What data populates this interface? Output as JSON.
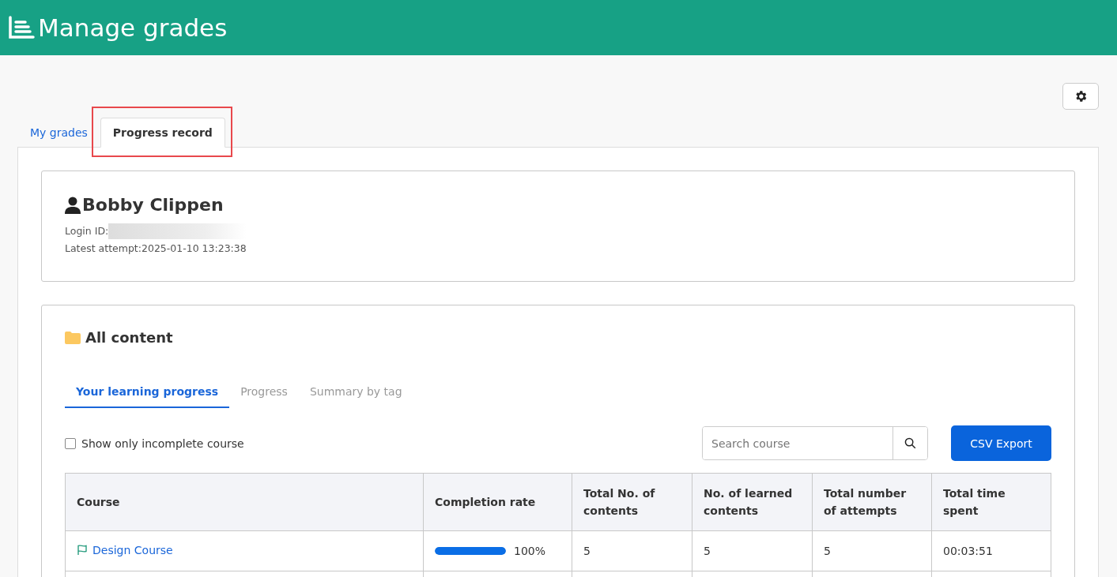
{
  "header": {
    "title": "Manage grades"
  },
  "page_tabs": [
    {
      "label": "My grades",
      "selected": false
    },
    {
      "label": "Progress record",
      "selected": true
    }
  ],
  "profile": {
    "name": "Bobby Clippen",
    "login_id_label": "Login ID:",
    "latest_attempt": "Latest attempt:2025-01-10 13:23:38"
  },
  "content": {
    "title": "All content",
    "tabs": [
      {
        "label": "Your learning progress",
        "selected": true
      },
      {
        "label": "Progress",
        "selected": false
      },
      {
        "label": "Summary by tag",
        "selected": false
      }
    ],
    "filter": {
      "label": "Show only incomplete course",
      "checked": false
    },
    "search": {
      "placeholder": "Search course"
    },
    "export_button": "CSV Export",
    "table": {
      "columns": [
        "Course",
        "Completion rate",
        "Total No. of contents",
        "No. of learned contents",
        "Total number of attempts",
        "Total time spent"
      ],
      "rows": [
        {
          "course": "Design Course",
          "level": 1,
          "rate": "100%",
          "total": "5",
          "learned": "5",
          "attempts": "5",
          "time": "00:03:51"
        }
      ]
    }
  }
}
